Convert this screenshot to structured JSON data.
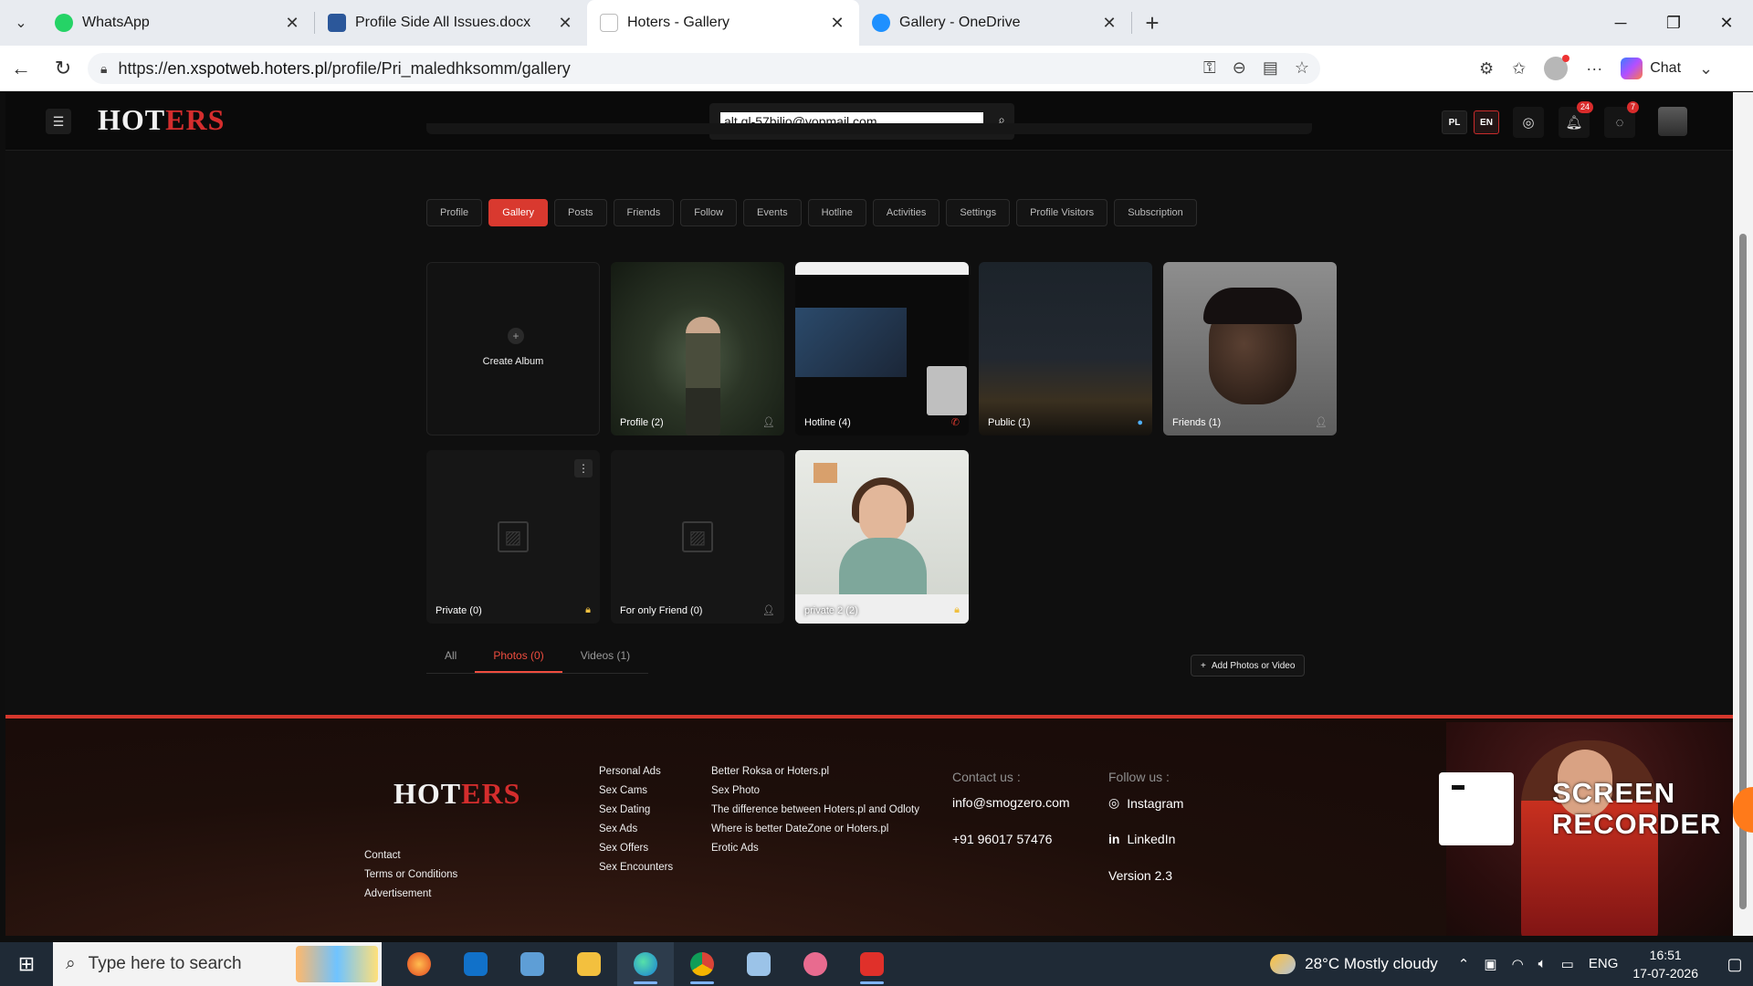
{
  "browser": {
    "tabs": [
      {
        "title": "WhatsApp",
        "favicon_color": "#25d366",
        "active": false
      },
      {
        "title": "Profile Side All Issues.docx",
        "favicon_color": "#2b579a",
        "active": false
      },
      {
        "title": "Hoters - Gallery",
        "favicon_color": "#cfd6e0",
        "active": true
      },
      {
        "title": "Gallery - OneDrive",
        "favicon_color": "#1e90ff",
        "active": false
      }
    ],
    "url_prefix": "https://",
    "url_host": "en.xspotweb.hoters.pl",
    "url_path": "/profile/Pri_maledhksomm/gallery",
    "chat_label": "Chat"
  },
  "site": {
    "logo_left": "HOT",
    "logo_right": "ERS",
    "search_value": "alt.gl-57biljo@yopmail.com",
    "lang_pl": "PL",
    "lang_en": "EN",
    "notif_count": "24",
    "msg_count": "7"
  },
  "profile_tabs": [
    "Profile",
    "Gallery",
    "Posts",
    "Friends",
    "Follow",
    "Events",
    "Hotline",
    "Activities",
    "Settings",
    "Profile Visitors",
    "Subscription"
  ],
  "active_profile_tab": "Gallery",
  "albums": {
    "create_label": "Create Album",
    "items": [
      {
        "label": "Profile (2)",
        "privacy_icon": "user-icon"
      },
      {
        "label": "Hotline (4)",
        "privacy_icon": "phone-icon"
      },
      {
        "label": "Public (1)",
        "privacy_icon": "globe-icon"
      },
      {
        "label": "Friends (1)",
        "privacy_icon": "user-icon"
      },
      {
        "label": "Private (0)",
        "privacy_icon": "lock-icon"
      },
      {
        "label": "For only Friend (0)",
        "privacy_icon": "user-icon"
      },
      {
        "label": "private 2 (2)",
        "privacy_icon": "lock-icon"
      }
    ]
  },
  "media_tabs": {
    "all": "All",
    "photos": "Photos (0)",
    "videos": "Videos (1)",
    "active": "Photos (0)"
  },
  "add_media_label": "Add Photos or Video",
  "footer": {
    "links_left": [
      "Contact",
      "Terms or Conditions",
      "Advertisement"
    ],
    "links_col1": [
      "Personal Ads",
      "Sex Cams",
      "Sex Dating",
      "Sex Ads",
      "Sex Offers",
      "Sex Encounters"
    ],
    "links_col2": [
      "Better Roksa or Hoters.pl",
      "Sex Photo",
      "The difference between Hoters.pl and Odloty",
      "Where is better DateZone or Hoters.pl",
      "Erotic Ads"
    ],
    "contact_heading": "Contact us :",
    "email": "info@smogzero.com",
    "phone": "+91 96017 57476",
    "follow_heading": "Follow us :",
    "instagram": "Instagram",
    "linkedin": "LinkedIn",
    "version": "Version 2.3"
  },
  "overlay": {
    "recorder_line1": "SCREEN",
    "recorder_line2": "RECORDER"
  },
  "taskbar": {
    "search_placeholder": "Type here to search",
    "weather": "28°C  Mostly cloudy",
    "lang": "ENG",
    "time": "16:51",
    "date": "17-07-2026"
  },
  "colors": {
    "accent": "#d9392f",
    "footer_border": "#d6372c"
  }
}
